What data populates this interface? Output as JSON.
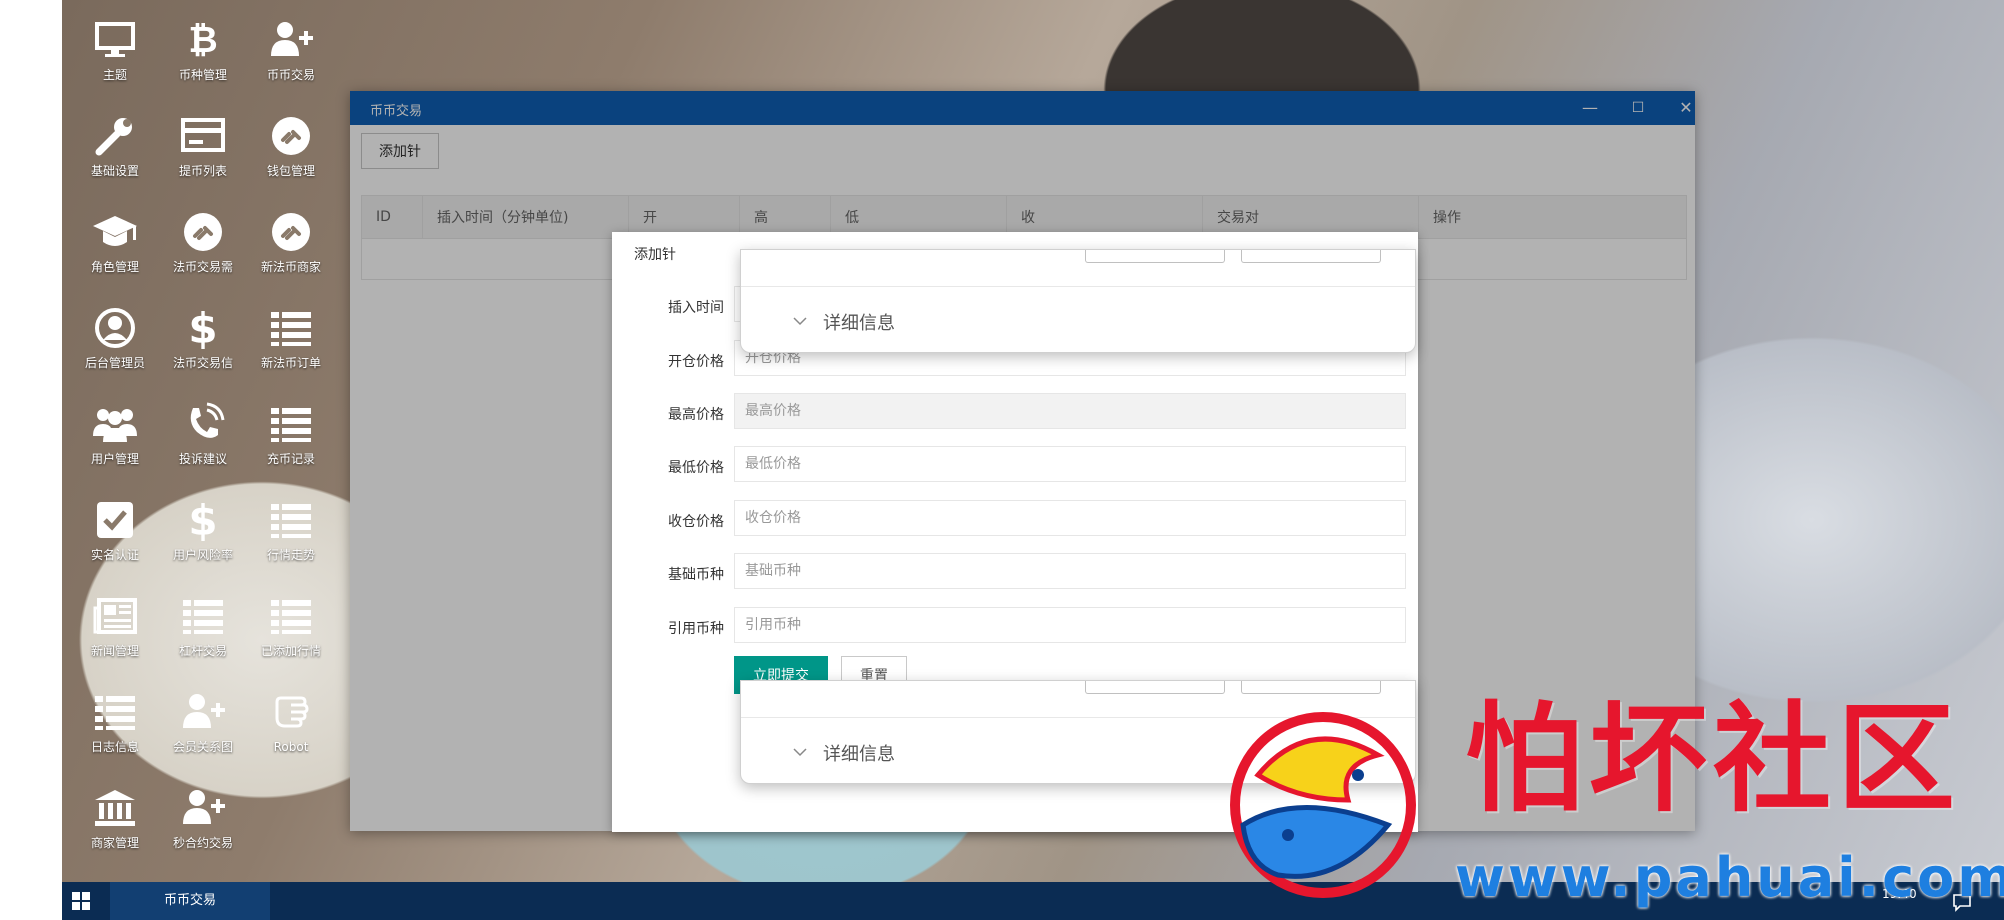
{
  "desktop": {
    "icons": [
      {
        "label": "主题",
        "icon": "monitor-icon"
      },
      {
        "label": "币种管理",
        "icon": "bitcoin-icon"
      },
      {
        "label": "币币交易",
        "icon": "user-add-icon"
      },
      {
        "label": "基础设置",
        "icon": "wrench-icon"
      },
      {
        "label": "提币列表",
        "icon": "credit-card-icon"
      },
      {
        "label": "钱包管理",
        "icon": "link-circle-icon"
      },
      {
        "label": "角色管理",
        "icon": "graduation-cap-icon"
      },
      {
        "label": "法币交易需",
        "icon": "link-circle-icon"
      },
      {
        "label": "新法币商家",
        "icon": "link-circle-icon"
      },
      {
        "label": "后台管理员",
        "icon": "user-circle-icon"
      },
      {
        "label": "法币交易信",
        "icon": "dollar-icon"
      },
      {
        "label": "新法币订单",
        "icon": "list-icon"
      },
      {
        "label": "用户管理",
        "icon": "users-icon"
      },
      {
        "label": "投诉建议",
        "icon": "phone-icon"
      },
      {
        "label": "充币记录",
        "icon": "list-icon"
      },
      {
        "label": "实名认证",
        "icon": "checkbox-icon"
      },
      {
        "label": "用户风险率",
        "icon": "dollar-icon"
      },
      {
        "label": "行情走势",
        "icon": "list-icon"
      },
      {
        "label": "新闻管理",
        "icon": "newspaper-icon"
      },
      {
        "label": "杠杆交易",
        "icon": "list-icon"
      },
      {
        "label": "已添加行情",
        "icon": "list-icon"
      },
      {
        "label": "日志信息",
        "icon": "list-icon"
      },
      {
        "label": "会员关系图",
        "icon": "user-add-icon"
      },
      {
        "label": "Robot",
        "icon": "hand-icon"
      },
      {
        "label": "商家管理",
        "icon": "bank-icon"
      },
      {
        "label": "秒合约交易",
        "icon": "user-add-icon"
      }
    ]
  },
  "window": {
    "title": "币币交易",
    "minimize": "—",
    "maximize": "☐",
    "close": "✕",
    "add_button": "添加针",
    "table": {
      "columns": [
        "ID",
        "插入时间（分钟单位)",
        "开",
        "高",
        "低",
        "收",
        "交易对",
        "操作"
      ]
    }
  },
  "dialog": {
    "title": "添加针",
    "fields": [
      {
        "label": "插入时间",
        "placeholder": ""
      },
      {
        "label": "开仓价格",
        "placeholder": "开仓价格"
      },
      {
        "label": "最高价格",
        "placeholder": "最高价格"
      },
      {
        "label": "最低价格",
        "placeholder": "最低价格"
      },
      {
        "label": "收仓价格",
        "placeholder": "收仓价格"
      },
      {
        "label": "基础币种",
        "placeholder": "基础币种"
      },
      {
        "label": "引用币种",
        "placeholder": "引用币种"
      }
    ],
    "submit": "立即提交",
    "reset": "重置"
  },
  "popovers": [
    {
      "details": "详细信息"
    },
    {
      "details": "详细信息"
    }
  ],
  "taskbar": {
    "active_task": "币币交易",
    "clock": "19:40"
  },
  "watermark": {
    "text": "怕坏社区",
    "url": "www.pahuai.com"
  },
  "colors": {
    "title_bar": "#0f5fb5",
    "primary_button": "#009688",
    "taskbar": "#0b2c53",
    "watermark_red": "#e6162d",
    "watermark_blue": "#1e7fe0"
  }
}
